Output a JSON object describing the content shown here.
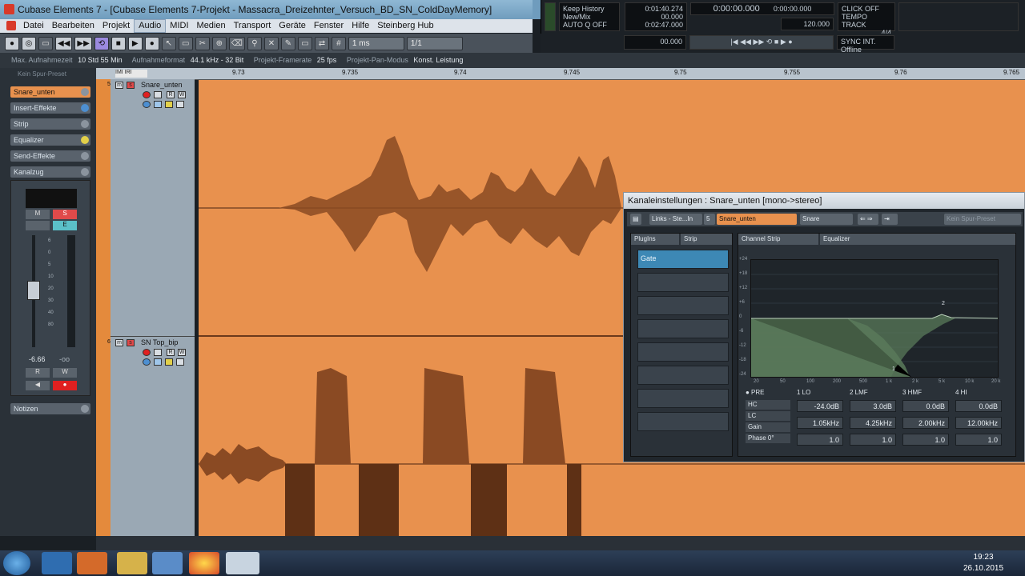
{
  "window": {
    "title": "Cubase Elements 7 - [Cubase Elements 7-Projekt - Massacra_Dreizehnter_Versuch_BD_SN_ColdDayMemory]"
  },
  "menu": [
    "Datei",
    "Bearbeiten",
    "Projekt",
    "Audio",
    "MIDI",
    "Medien",
    "Transport",
    "Geräte",
    "Fenster",
    "Hilfe",
    "Steinberg Hub"
  ],
  "menu_active": "Audio",
  "toolbar": {
    "quantize_label": "1 ms",
    "grid_label": "1/1"
  },
  "transport": {
    "keep_history": "Keep History",
    "new_mix": "New/Mix",
    "auto_q": "AUTO Q",
    "auto_q_state": "OFF",
    "left_locator": "0:01:40.274",
    "left_sub": "00.000",
    "right_locator": "0:02:47.000",
    "right_sub": "00.000",
    "main_time": "0:00:00.000",
    "sub_time": "0:00:00.000",
    "click": "CLICK",
    "click_state": "OFF",
    "tempo": "TEMPO",
    "tempo_mode": "TRACK",
    "signature": "4/4",
    "bpm": "120.000",
    "sync": "SYNC",
    "sync_src": "INT.",
    "sync_state": "Offline"
  },
  "infobar": {
    "max_rec_label": "Max. Aufnahmezeit",
    "max_rec_value": "10 Std 55 Min",
    "format_label": "Aufnahmeformat",
    "format_value": "44.1 kHz - 32 Bit",
    "framerate_label": "Projekt-Framerate",
    "framerate_value": "25 fps",
    "pan_label": "Projekt-Pan-Modus",
    "pan_value": "Konst. Leistung"
  },
  "inspector": {
    "preset": "Kein Spur-Preset",
    "track_name": "Snare_unten",
    "sections": [
      "Insert-Effekte",
      "Strip",
      "Equalizer",
      "Send-Effekte",
      "Kanalzug"
    ],
    "notes": "Notizen",
    "fader_value": "-6.66",
    "fader_value2": "-oo",
    "meter_scale": [
      "6",
      "0",
      "5",
      "10",
      "20",
      "30",
      "40",
      "80"
    ]
  },
  "tracks": [
    {
      "num": "5",
      "name": "Snare_unten"
    },
    {
      "num": "6",
      "name": "SN Top_bip"
    }
  ],
  "ruler": {
    "ticks": [
      "9.73",
      "9.735",
      "9.74",
      "9.745",
      "9.75",
      "9.755",
      "9.76",
      "9.765"
    ]
  },
  "channel_window": {
    "title": "Kanaleinstellungen : Snare_unten [mono->stereo]",
    "links": "Links - Ste...In",
    "channel_num": "5",
    "channel_name": "Snare_unten",
    "output": "Snare",
    "preset": "Kein Spur-Preset",
    "tab_plugins": "PlugIns",
    "tab_strip": "Strip",
    "tab_channel_strip": "Channel Strip",
    "tab_equalizer": "Equalizer",
    "insert_slots": [
      "Gate",
      "",
      "",
      "",
      "",
      "",
      "",
      ""
    ],
    "eq": {
      "db_scale": [
        "+24",
        "+18",
        "+12",
        "+6",
        "0",
        "-6",
        "-12",
        "-18",
        "-24"
      ],
      "freq_scale": [
        "20",
        "50",
        "100",
        "200",
        "500",
        "1 k",
        "2 k",
        "5 k",
        "10 k",
        "20 k"
      ],
      "pre": "PRE",
      "bands": [
        {
          "num": "1",
          "type": "LO",
          "gain": "-24.0dB",
          "freq": "1.05kHz",
          "q": "1.0"
        },
        {
          "num": "2",
          "type": "LMF",
          "gain": "3.0dB",
          "freq": "4.25kHz",
          "q": "1.0"
        },
        {
          "num": "3",
          "type": "HMF",
          "gain": "0.0dB",
          "freq": "2.00kHz",
          "q": "1.0"
        },
        {
          "num": "4",
          "type": "HI",
          "gain": "0.0dB",
          "freq": "12.00kHz",
          "q": "1.0"
        }
      ],
      "options": [
        "HC",
        "LC",
        "Gain",
        "Phase 0°"
      ],
      "curve_points": [
        "1",
        "2"
      ]
    }
  },
  "taskbar": {
    "time": "19:23",
    "date": "26.10.2015"
  },
  "colors": {
    "track_orange": "#e8914e",
    "waveform": "#8a4a23",
    "eq_fill": "#5a7a5a",
    "accent_blue": "#3d88b5"
  }
}
